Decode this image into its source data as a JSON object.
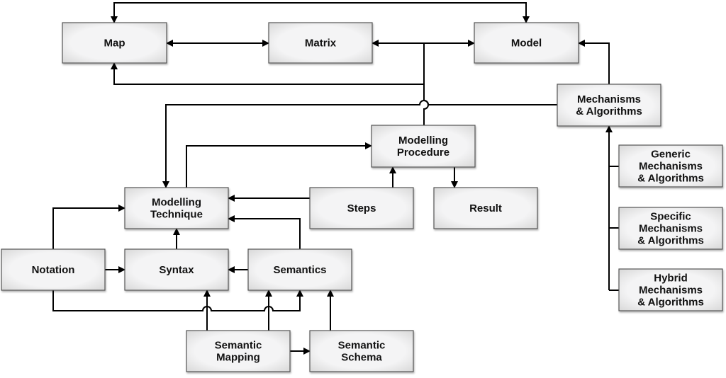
{
  "nodes": {
    "map": {
      "lines": [
        "Map"
      ]
    },
    "matrix": {
      "lines": [
        "Matrix"
      ]
    },
    "model": {
      "lines": [
        "Model"
      ]
    },
    "mechanisms": {
      "lines": [
        "Mechanisms",
        "& Algorithms"
      ]
    },
    "procedure": {
      "lines": [
        "Modelling",
        "Procedure"
      ]
    },
    "technique": {
      "lines": [
        "Modelling",
        "Technique"
      ]
    },
    "steps": {
      "lines": [
        "Steps"
      ]
    },
    "result": {
      "lines": [
        "Result"
      ]
    },
    "notation": {
      "lines": [
        "Notation"
      ]
    },
    "syntax": {
      "lines": [
        "Syntax"
      ]
    },
    "semantics": {
      "lines": [
        "Semantics"
      ]
    },
    "mapping": {
      "lines": [
        "Semantic",
        "Mapping"
      ]
    },
    "schema": {
      "lines": [
        "Semantic",
        "Schema"
      ]
    },
    "generic": {
      "lines": [
        "Generic",
        "Mechanisms",
        "& Algorithms"
      ]
    },
    "specific": {
      "lines": [
        "Specific",
        "Mechanisms",
        "& Algorithms"
      ]
    },
    "hybrid": {
      "lines": [
        "Hybrid",
        "Mechanisms",
        "& Algorithms"
      ]
    }
  },
  "colors": {
    "box_fill": "#f2f2f2",
    "box_border": "#555555",
    "line": "#000000"
  }
}
